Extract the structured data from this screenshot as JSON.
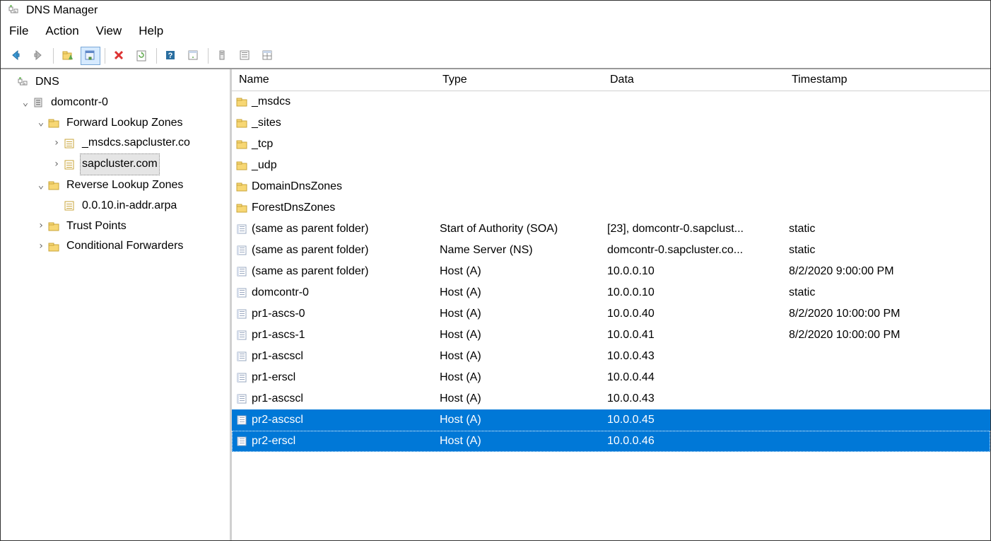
{
  "window": {
    "title": "DNS Manager"
  },
  "menus": {
    "file": "File",
    "action": "Action",
    "view": "View",
    "help": "Help"
  },
  "tree": {
    "root": "DNS",
    "server": "domcontr-0",
    "fwd_zones": "Forward Lookup Zones",
    "fwd_children": [
      "_msdcs.sapcluster.co",
      "sapcluster.com"
    ],
    "rev_zones": "Reverse Lookup Zones",
    "rev_children": [
      "0.0.10.in-addr.arpa"
    ],
    "trust": "Trust Points",
    "cond": "Conditional Forwarders"
  },
  "columns": {
    "name": "Name",
    "type": "Type",
    "data": "Data",
    "timestamp": "Timestamp"
  },
  "records": [
    {
      "name": "_msdcs",
      "type": "",
      "data": "",
      "ts": "",
      "icon": "folder"
    },
    {
      "name": "_sites",
      "type": "",
      "data": "",
      "ts": "",
      "icon": "folder"
    },
    {
      "name": "_tcp",
      "type": "",
      "data": "",
      "ts": "",
      "icon": "folder"
    },
    {
      "name": "_udp",
      "type": "",
      "data": "",
      "ts": "",
      "icon": "folder"
    },
    {
      "name": "DomainDnsZones",
      "type": "",
      "data": "",
      "ts": "",
      "icon": "folder"
    },
    {
      "name": "ForestDnsZones",
      "type": "",
      "data": "",
      "ts": "",
      "icon": "folder"
    },
    {
      "name": "(same as parent folder)",
      "type": "Start of Authority (SOA)",
      "data": "[23], domcontr-0.sapclust...",
      "ts": "static",
      "icon": "rec"
    },
    {
      "name": "(same as parent folder)",
      "type": "Name Server (NS)",
      "data": "domcontr-0.sapcluster.co...",
      "ts": "static",
      "icon": "rec"
    },
    {
      "name": "(same as parent folder)",
      "type": "Host (A)",
      "data": "10.0.0.10",
      "ts": "8/2/2020 9:00:00 PM",
      "icon": "rec"
    },
    {
      "name": "domcontr-0",
      "type": "Host (A)",
      "data": "10.0.0.10",
      "ts": "static",
      "icon": "rec"
    },
    {
      "name": "pr1-ascs-0",
      "type": "Host (A)",
      "data": "10.0.0.40",
      "ts": "8/2/2020 10:00:00 PM",
      "icon": "rec"
    },
    {
      "name": "pr1-ascs-1",
      "type": "Host (A)",
      "data": "10.0.0.41",
      "ts": "8/2/2020 10:00:00 PM",
      "icon": "rec"
    },
    {
      "name": "pr1-ascscl",
      "type": "Host (A)",
      "data": "10.0.0.43",
      "ts": "",
      "icon": "rec"
    },
    {
      "name": "pr1-erscl",
      "type": "Host (A)",
      "data": "10.0.0.44",
      "ts": "",
      "icon": "rec"
    },
    {
      "name": "pr1-ascscl",
      "type": "Host (A)",
      "data": "10.0.0.43",
      "ts": "",
      "icon": "rec"
    },
    {
      "name": "pr2-ascscl",
      "type": "Host (A)",
      "data": "10.0.0.45",
      "ts": "",
      "icon": "rec",
      "selected": true
    },
    {
      "name": "pr2-erscl",
      "type": "Host (A)",
      "data": "10.0.0.46",
      "ts": "",
      "icon": "rec",
      "selected": true,
      "focus": true
    }
  ]
}
